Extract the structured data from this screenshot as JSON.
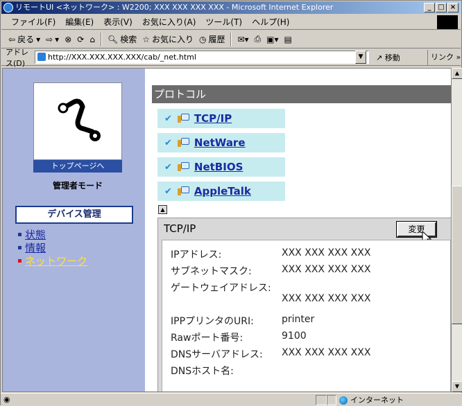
{
  "window": {
    "title": "リモートUI <ネットワーク> : W2200; XXX XXX XXX XXX - Microsoft Internet Explorer"
  },
  "menu": [
    "ファイル(F)",
    "編集(E)",
    "表示(V)",
    "お気に入り(A)",
    "ツール(T)",
    "ヘルプ(H)"
  ],
  "toolbar": {
    "back": "戻る",
    "search": "検索",
    "favorites": "お気に入り",
    "history": "履歴"
  },
  "address": {
    "label": "アドレス(D)",
    "url": "http://XXX.XXX.XXX.XXX/cab/_net.html",
    "go": "移動",
    "links": "リンク »"
  },
  "status": {
    "zone": "インターネット"
  },
  "leftnav": {
    "top_page": "トップページへ",
    "admin_mode": "管理者モード",
    "device_mgmt": "デバイス管理",
    "links": [
      {
        "label": "状態",
        "active": false
      },
      {
        "label": "情報",
        "active": false
      },
      {
        "label": "ネットワーク",
        "active": true
      }
    ]
  },
  "content": {
    "section": "プロトコル",
    "protocols": [
      "TCP/IP",
      "NetWare",
      "NetBIOS",
      "AppleTalk"
    ],
    "panel": {
      "title": "TCP/IP",
      "change_button": "変更",
      "rows": [
        {
          "label": "IPアドレス:",
          "value": "XXX XXX XXX XXX"
        },
        {
          "label": "サブネットマスク:",
          "value": "XXX XXX XXX XXX"
        },
        {
          "label": "ゲートウェイアドレス:",
          "value": "XXX XXX XXX XXX"
        },
        {
          "label": "IPPプリンタのURI:",
          "value": "printer"
        },
        {
          "label": "Rawポート番号:",
          "value": "9100"
        },
        {
          "label": "DNSサーバアドレス:",
          "value": "XXX XXX XXX XXX"
        },
        {
          "label": "DNSホスト名:",
          "value": ""
        }
      ]
    }
  }
}
